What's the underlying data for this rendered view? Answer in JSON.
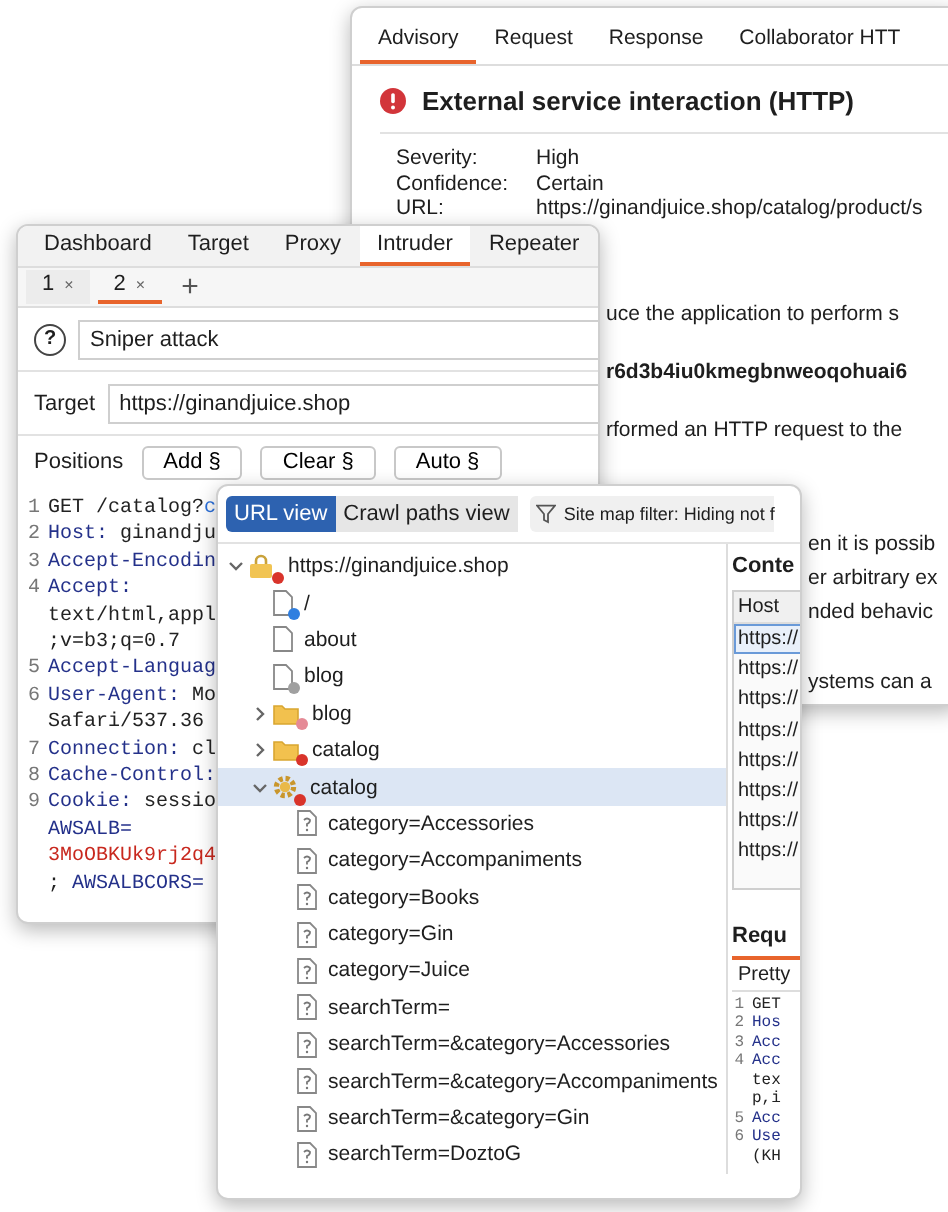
{
  "advisory_window": {
    "tabs": [
      {
        "label": "Advisory",
        "selected": true
      },
      {
        "label": "Request",
        "selected": false
      },
      {
        "label": "Response",
        "selected": false
      },
      {
        "label": "Collaborator HTT",
        "selected": false
      }
    ],
    "title": "External service interaction (HTTP)",
    "details": [
      {
        "label": "Severity:",
        "value": "High"
      },
      {
        "label": "Confidence:",
        "value": "Certain"
      },
      {
        "label": "URL:",
        "value": "https://ginandjuice.shop/catalog/product/s"
      }
    ],
    "paragraphs": [
      {
        "kind": "text",
        "lines": [
          "uce the application to perform s"
        ]
      },
      {
        "kind": "code",
        "lines": [
          "r6d3b4iu0kmegbnweoqohuai6"
        ]
      },
      {
        "kind": "text",
        "lines": [
          "rformed an HTTP request to the"
        ]
      },
      {
        "kind": "text",
        "lines": [
          "en it is possib",
          "er arbitrary ex",
          "nded behavic"
        ]
      },
      {
        "kind": "text",
        "lines": [
          "ystems can a"
        ]
      }
    ]
  },
  "intruder_window": {
    "tabs": [
      {
        "label": "Dashboard",
        "selected": false
      },
      {
        "label": "Target",
        "selected": false
      },
      {
        "label": "Proxy",
        "selected": false
      },
      {
        "label": "Intruder",
        "selected": true
      },
      {
        "label": "Repeater",
        "selected": false
      }
    ],
    "subtabs": [
      {
        "label": "1",
        "close": "×",
        "selected": false
      },
      {
        "label": "2",
        "close": "×",
        "selected": true
      }
    ],
    "add_tab": "+",
    "help": "?",
    "attack_type": "Sniper attack",
    "target_label": "Target",
    "target": "https://ginandjuice.shop",
    "positions_label": "Positions",
    "position_buttons": [
      "Add §",
      "Clear §",
      "Auto §"
    ],
    "request": [
      {
        "number": "1",
        "segments": [
          {
            "text": "GET /catalog?",
            "kind": "plain"
          },
          {
            "text": "c",
            "kind": "param"
          }
        ]
      },
      {
        "number": "2",
        "segments": [
          {
            "text": "Host:",
            "kind": "name"
          },
          {
            "text": " ginandju",
            "kind": "plain"
          }
        ]
      },
      {
        "number": "3",
        "segments": [
          {
            "text": "Accept-Encodin",
            "kind": "name"
          }
        ]
      },
      {
        "number": "4",
        "segments": [
          {
            "text": "Accept:",
            "kind": "name"
          }
        ]
      },
      {
        "segments": [
          {
            "text": "text/html,appl",
            "kind": "plain"
          }
        ]
      },
      {
        "segments": [
          {
            "text": ";v=b3;q=0.7",
            "kind": "plain"
          }
        ]
      },
      {
        "number": "5",
        "segments": [
          {
            "text": "Accept-Languag",
            "kind": "name"
          }
        ]
      },
      {
        "number": "6",
        "segments": [
          {
            "text": "User-Agent:",
            "kind": "name"
          },
          {
            "text": " Mo",
            "kind": "plain"
          }
        ]
      },
      {
        "segments": [
          {
            "text": "Safari/537.36",
            "kind": "plain"
          }
        ]
      },
      {
        "number": "7",
        "segments": [
          {
            "text": "Connection:",
            "kind": "name"
          },
          {
            "text": " cl",
            "kind": "plain"
          }
        ]
      },
      {
        "number": "8",
        "segments": [
          {
            "text": "Cache-Control:",
            "kind": "name"
          }
        ]
      },
      {
        "number": "9",
        "segments": [
          {
            "text": "Cookie:",
            "kind": "name"
          },
          {
            "text": " sessio",
            "kind": "plain"
          }
        ]
      },
      {
        "segments": [
          {
            "text": "AWSALB=",
            "kind": "name"
          }
        ]
      },
      {
        "segments": [
          {
            "text": "3MoOBKUk9rj2q4",
            "kind": "cookie"
          }
        ]
      },
      {
        "segments": [
          {
            "text": ";",
            "kind": "plain"
          },
          {
            "text": " AWSALBCORS=",
            "kind": "name"
          }
        ]
      }
    ]
  },
  "site_map_window": {
    "views": [
      {
        "label": "URL view",
        "selected": true
      },
      {
        "label": "Crawl paths view",
        "selected": false
      }
    ],
    "filter": "Site map filter: Hiding not f",
    "tree": [
      {
        "label": "https://ginandjuice.shop",
        "kind": "host",
        "color": "#d9342b",
        "expanded": true,
        "selected": false,
        "children": [
          {
            "label": "/",
            "kind": "file",
            "color": "#2f7fe0",
            "selected": false
          },
          {
            "label": "about",
            "kind": "file",
            "selected": false
          },
          {
            "label": "blog",
            "kind": "file",
            "color": "#a0a0a0",
            "selected": false
          },
          {
            "label": "blog",
            "kind": "folder",
            "color": "#e58a96",
            "expanded": false,
            "selected": false
          },
          {
            "label": "catalog",
            "kind": "folder",
            "color": "#d9342b",
            "expanded": false,
            "selected": false
          },
          {
            "label": "catalog",
            "kind": "script",
            "color": "#d9342b",
            "expanded": true,
            "selected": true,
            "children": [
              {
                "label": "category=Accessories",
                "kind": "query",
                "selected": false
              },
              {
                "label": "category=Accompaniments",
                "kind": "query",
                "selected": false
              },
              {
                "label": "category=Books",
                "kind": "query",
                "selected": false
              },
              {
                "label": "category=Gin",
                "kind": "query",
                "selected": false
              },
              {
                "label": "category=Juice",
                "kind": "query",
                "selected": false
              },
              {
                "label": "searchTerm=",
                "kind": "query",
                "selected": false
              },
              {
                "label": "searchTerm=&category=Accessories",
                "kind": "query",
                "selected": false
              },
              {
                "label": "searchTerm=&category=Accompaniments",
                "kind": "query",
                "selected": false
              },
              {
                "label": "searchTerm=&category=Gin",
                "kind": "query",
                "selected": false
              },
              {
                "label": "searchTerm=DoztoG",
                "kind": "query",
                "selected": false
              }
            ]
          }
        ]
      }
    ],
    "content_heading": "Conte",
    "host_header": "Host",
    "hosts": [
      {
        "text": "https://",
        "selected": true
      },
      {
        "text": "https://",
        "selected": false
      },
      {
        "text": "https://",
        "selected": false
      },
      {
        "text": "https://",
        "selected": false
      },
      {
        "text": "https://",
        "selected": false
      },
      {
        "text": "https://",
        "selected": false
      },
      {
        "text": "https://",
        "selected": false
      },
      {
        "text": "https://",
        "selected": false
      }
    ],
    "request_heading": "Requ",
    "request_tab": "Pretty",
    "request": [
      {
        "number": "1",
        "segments": [
          {
            "text": "GET",
            "kind": "plain"
          }
        ]
      },
      {
        "number": "2",
        "segments": [
          {
            "text": "Hos",
            "kind": "name"
          }
        ]
      },
      {
        "number": "3",
        "segments": [
          {
            "text": "Acc",
            "kind": "name"
          }
        ]
      },
      {
        "number": "4",
        "segments": [
          {
            "text": "Acc",
            "kind": "name"
          }
        ]
      },
      {
        "segments": [
          {
            "text": "tex",
            "kind": "plain"
          }
        ]
      },
      {
        "segments": [
          {
            "text": "p,i",
            "kind": "plain"
          }
        ]
      },
      {
        "number": "5",
        "segments": [
          {
            "text": "Acc",
            "kind": "name"
          }
        ]
      },
      {
        "number": "6",
        "segments": [
          {
            "text": "Use",
            "kind": "name"
          }
        ]
      },
      {
        "segments": [
          {
            "text": "(KH",
            "kind": "plain"
          }
        ]
      }
    ]
  }
}
